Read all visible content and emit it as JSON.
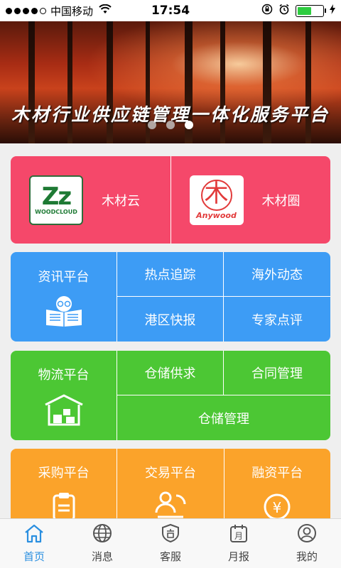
{
  "status_bar": {
    "carrier": "中国移动",
    "time": "17:54"
  },
  "banner": {
    "title": "木材行业供应链管理一体化服务平台",
    "slides": 3,
    "active_slide": 1
  },
  "featured": [
    {
      "label": "木材云",
      "logo_text": "WOODCLOUD"
    },
    {
      "label": "木材圈",
      "logo_text": "Anywood"
    }
  ],
  "info": {
    "main": "资讯平台",
    "items": [
      "热点追踪",
      "海外动态",
      "港区快报",
      "专家点评"
    ]
  },
  "logistics": {
    "main": "物流平台",
    "items": [
      "仓储供求",
      "合同管理",
      "仓储管理"
    ]
  },
  "services": [
    "采购平台",
    "交易平台",
    "融资平台"
  ],
  "tabs": [
    "首页",
    "消息",
    "客服",
    "月报",
    "我的"
  ],
  "colors": {
    "red": "#f5486a",
    "blue": "#3d9cf5",
    "green": "#4cc734",
    "orange": "#fba32a",
    "tab_active": "#2a8fe0"
  }
}
